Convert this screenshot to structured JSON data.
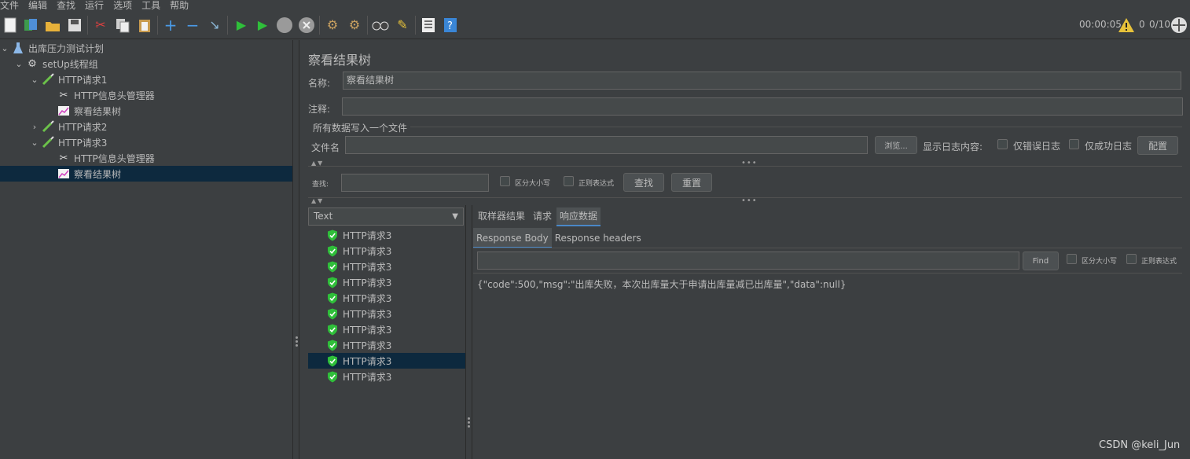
{
  "menu": [
    "文件",
    "编辑",
    "查找",
    "运行",
    "选项",
    "工具",
    "帮助"
  ],
  "toolbar": {
    "icons": [
      "new-icon",
      "templates-icon",
      "open-icon",
      "save-icon",
      "cut-icon",
      "copy-icon",
      "paste-icon",
      "expand-icon",
      "collapse-icon",
      "toggle-icon",
      "start-icon",
      "start-no-pause-icon",
      "stop-icon",
      "shutdown-icon",
      "clear-icon",
      "clear-all-icon",
      "search-icon",
      "reset-search-icon",
      "function-helper-icon",
      "help-icon"
    ],
    "timer": "00:00:05",
    "warnings": "0",
    "threads": "0/10"
  },
  "tree": [
    {
      "label": "出库压力测试计划",
      "icon": "test-plan-icon",
      "level": 0,
      "expanded": true
    },
    {
      "label": "setUp线程组",
      "icon": "gear-icon",
      "level": 1,
      "expanded": true
    },
    {
      "label": "HTTP请求1",
      "icon": "sampler-icon",
      "level": 2,
      "expanded": true
    },
    {
      "label": "HTTP信息头管理器",
      "icon": "tools-icon",
      "level": 3
    },
    {
      "label": "察看结果树",
      "icon": "listener-icon",
      "level": 3
    },
    {
      "label": "HTTP请求2",
      "icon": "sampler-icon",
      "level": 2,
      "expanded": false
    },
    {
      "label": "HTTP请求3",
      "icon": "sampler-icon",
      "level": 2,
      "expanded": true
    },
    {
      "label": "HTTP信息头管理器",
      "icon": "tools-icon",
      "level": 3
    },
    {
      "label": "察看结果树",
      "icon": "listener-icon",
      "level": 3,
      "selected": true
    }
  ],
  "panel": {
    "title": "察看结果树",
    "name_label": "名称:",
    "name_value": "察看结果树",
    "comment_label": "注释:",
    "comment_value": "",
    "file_group_label": "所有数据写入一个文件",
    "filename_label": "文件名",
    "browse_button": "浏览...",
    "log_content_label": "显示日志内容:",
    "errors_only_label": "仅错误日志",
    "success_only_label": "仅成功日志",
    "configure_button": "配置",
    "search_label": "查找:",
    "case_sensitive_label": "区分大小写",
    "regex_label": "正则表达式",
    "find_button": "查找",
    "reset_button": "重置"
  },
  "results": {
    "renderer": "Text",
    "items": [
      "HTTP请求3",
      "HTTP请求3",
      "HTTP请求3",
      "HTTP请求3",
      "HTTP请求3",
      "HTTP请求3",
      "HTTP请求3",
      "HTTP请求3",
      "HTTP请求3",
      "HTTP请求3"
    ],
    "selected_index": 8,
    "tabs": [
      "取样器结果",
      "请求",
      "响应数据"
    ],
    "active_tab": "响应数据",
    "subtabs": [
      "Response Body",
      "Response headers"
    ],
    "active_subtab": "Response Body",
    "find_button": "Find",
    "case_sensitive_label": "区分大小写",
    "regex_label": "正则表达式",
    "body": "{\"code\":500,\"msg\":\"出库失败，本次出库量大于申请出库量减已出库量\",\"data\":null}"
  },
  "watermark": "CSDN @keli_Jun",
  "colors": {
    "background": "#3c3f41",
    "selection": "#0d293e",
    "accent": "#4a88c7",
    "success": "#2fbf3a"
  }
}
